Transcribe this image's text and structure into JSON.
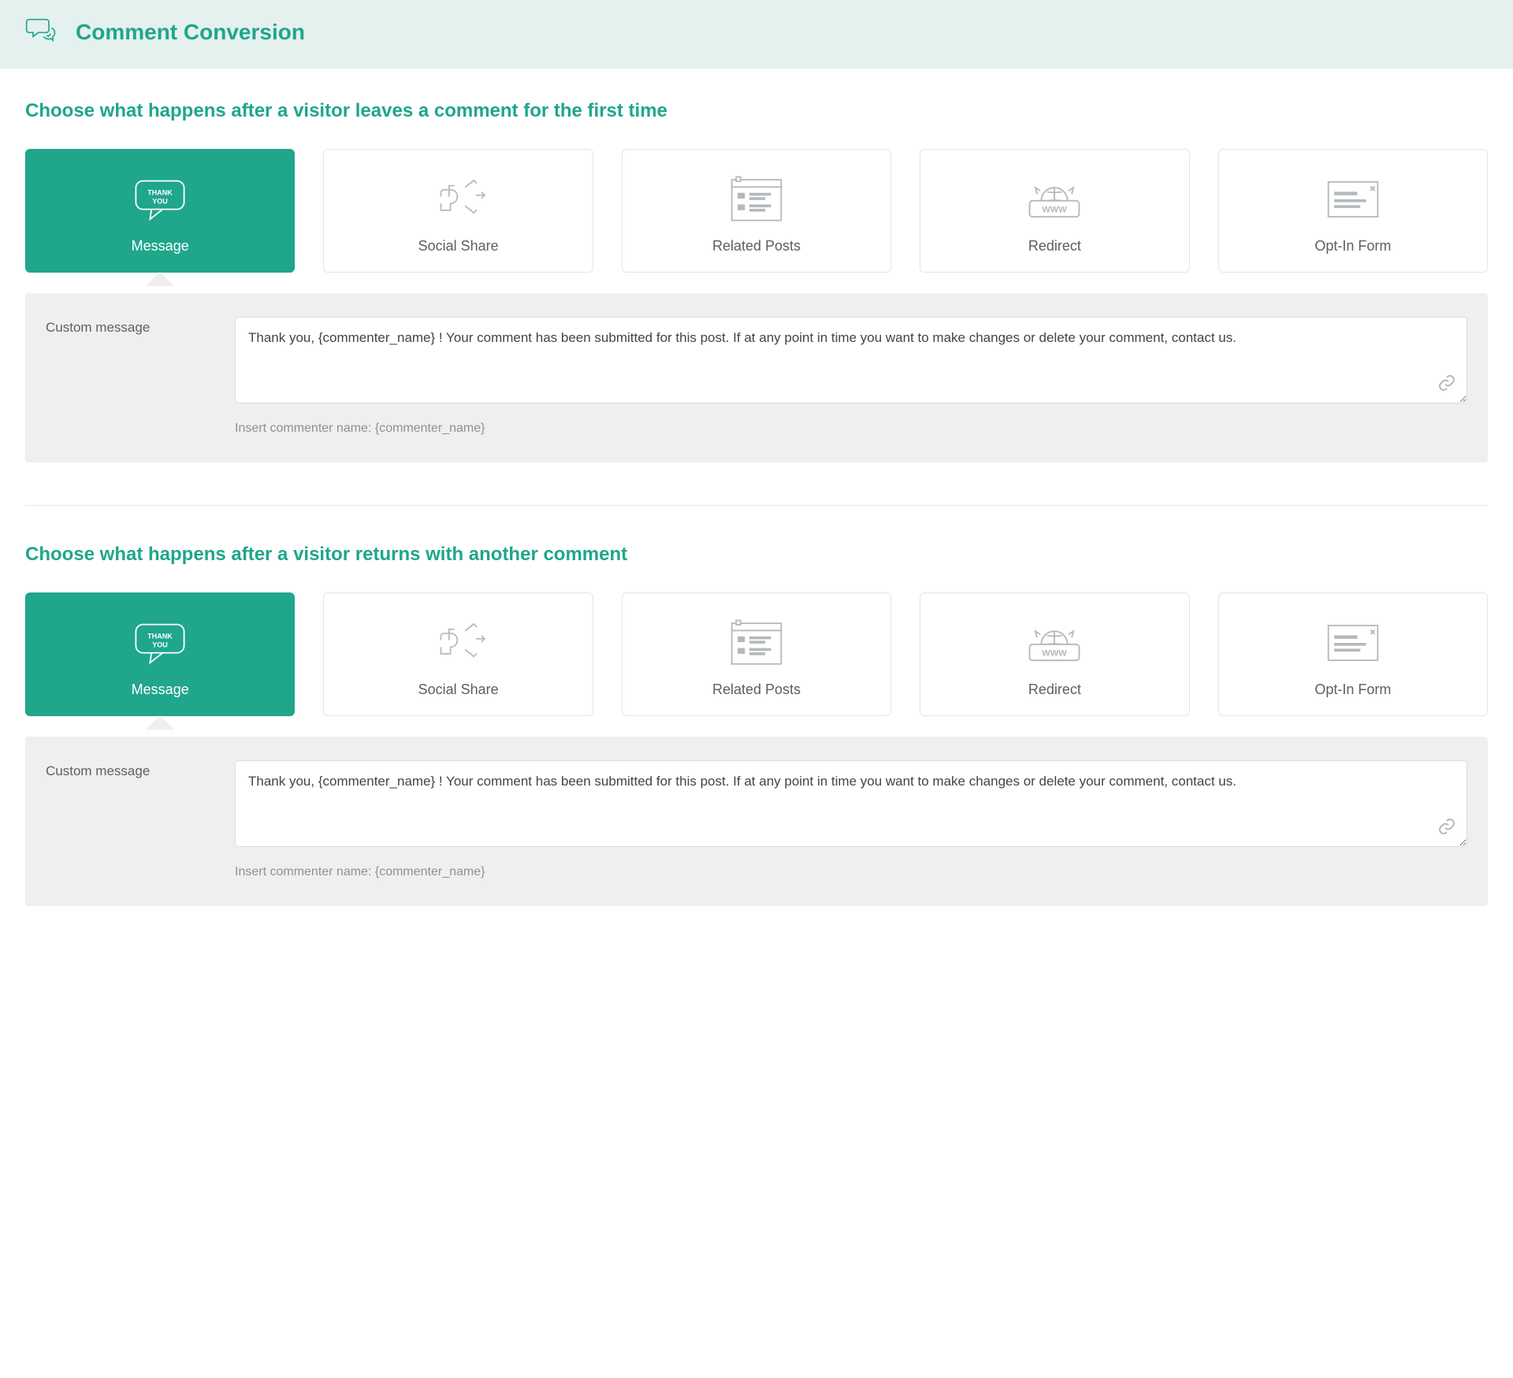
{
  "header": {
    "title": "Comment Conversion"
  },
  "sections": [
    {
      "title": "Choose what happens after a visitor leaves a comment for the first time",
      "cards": [
        {
          "id": "message",
          "label": "Message",
          "active": true
        },
        {
          "id": "social-share",
          "label": "Social Share",
          "active": false
        },
        {
          "id": "related-posts",
          "label": "Related Posts",
          "active": false
        },
        {
          "id": "redirect",
          "label": "Redirect",
          "active": false
        },
        {
          "id": "opt-in-form",
          "label": "Opt-In Form",
          "active": false
        }
      ],
      "panel": {
        "label": "Custom message",
        "value": "Thank you, {commenter_name} ! Your comment has been submitted for this post. If at any point in time you want to make changes or delete your comment, contact us.",
        "hint": "Insert commenter name: {commenter_name}"
      }
    },
    {
      "title": "Choose what happens after a visitor returns with another comment",
      "cards": [
        {
          "id": "message",
          "label": "Message",
          "active": true
        },
        {
          "id": "social-share",
          "label": "Social Share",
          "active": false
        },
        {
          "id": "related-posts",
          "label": "Related Posts",
          "active": false
        },
        {
          "id": "redirect",
          "label": "Redirect",
          "active": false
        },
        {
          "id": "opt-in-form",
          "label": "Opt-In Form",
          "active": false
        }
      ],
      "panel": {
        "label": "Custom message",
        "value": "Thank you, {commenter_name} ! Your comment has been submitted for this post. If at any point in time you want to make changes or delete your comment, contact us.",
        "hint": "Insert commenter name: {commenter_name}"
      }
    }
  ],
  "icons": {
    "message_sub_top": "THANK",
    "message_sub_bottom": "YOU"
  }
}
